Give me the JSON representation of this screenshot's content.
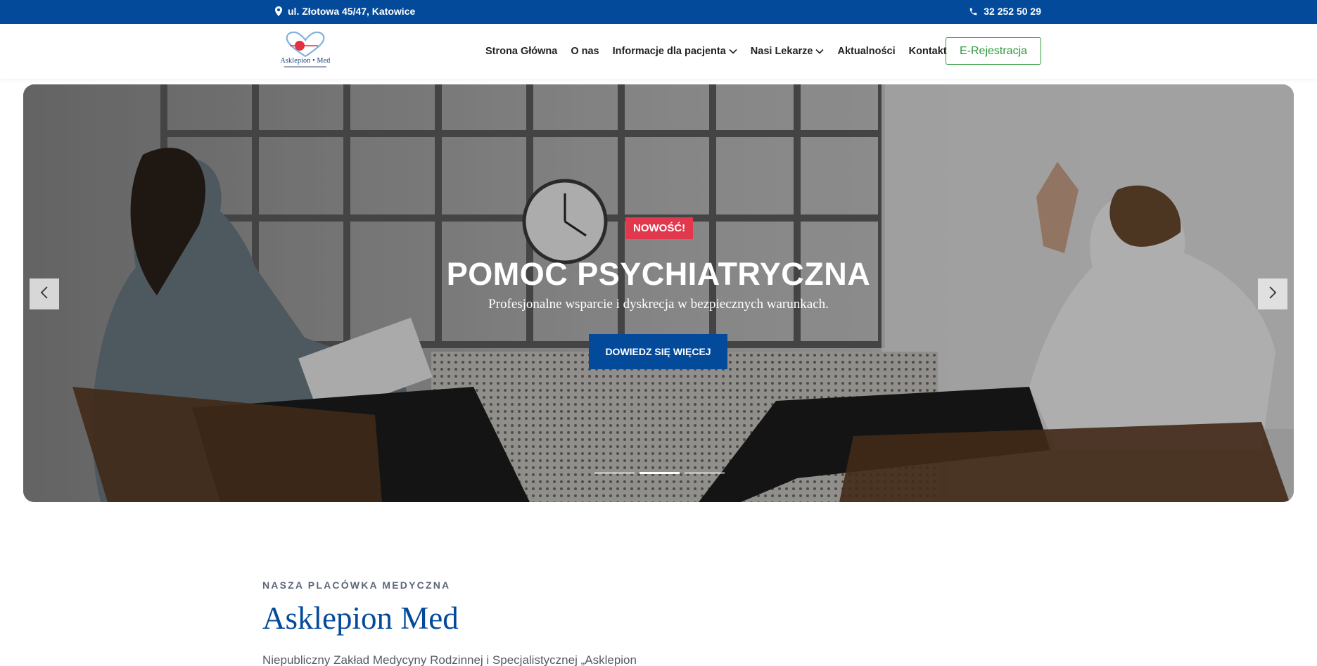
{
  "topbar": {
    "address": "ul. Złotowa 45/47, Katowice",
    "phone": "32 252 50 29",
    "bg_color": "#034a9b"
  },
  "header": {
    "logo_text": "Asklepion • Med",
    "nav": [
      {
        "label": "Strona Główna",
        "has_dropdown": false
      },
      {
        "label": "O nas",
        "has_dropdown": false
      },
      {
        "label": "Informacje dla pacjenta",
        "has_dropdown": true
      },
      {
        "label": "Nasi Lekarze",
        "has_dropdown": true
      },
      {
        "label": "Aktualności",
        "has_dropdown": false
      },
      {
        "label": "Kontakt",
        "has_dropdown": false
      }
    ],
    "cta_label": "E-Rejestracja",
    "cta_color": "#2e9a3a"
  },
  "hero": {
    "badge": "NOWOŚĆ!",
    "badge_color": "#e2384d",
    "title": "POMOC PSYCHIATRYCZNA",
    "subtitle": "Profesjonalne wsparcie i dyskrecja w bezpiecznych warunkach.",
    "button_label": "DOWIEDZ SIĘ WIĘCEJ",
    "button_color": "#034a9b",
    "slide_count": 3,
    "active_slide": 2,
    "prev_icon": "chevron-left-icon",
    "next_icon": "chevron-right-icon"
  },
  "about": {
    "kicker": "NASZA PLACÓWKA MEDYCZNA",
    "title": "Asklepion Med",
    "text": "Niepubliczny Zakład Medycyny Rodzinnej i Specjalistycznej „Asklepion"
  }
}
